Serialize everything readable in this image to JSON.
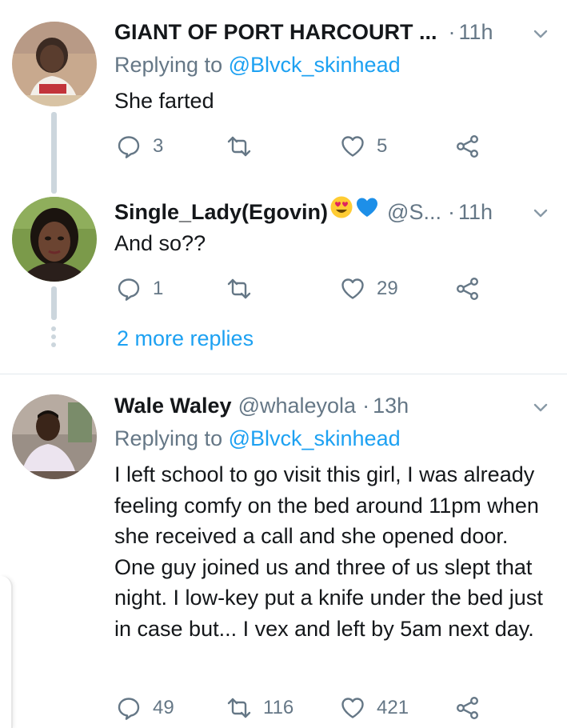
{
  "tweets": [
    {
      "name": "GIANT OF PORT HARCOURT ...",
      "handle": "",
      "time": "11h",
      "reply_prefix": "Replying to ",
      "reply_mention": "@Blvck_skinhead",
      "text": "She farted",
      "replies": "3",
      "retweets": "",
      "likes": "5"
    },
    {
      "name": "Single_Lady(Egovin)",
      "name_emojis": [
        "heart-eyes-emoji",
        "blue-heart-emoji"
      ],
      "handle": "@S...",
      "time": "11h",
      "text": "And so??",
      "replies": "1",
      "retweets": "",
      "likes": "29"
    },
    {
      "name": "Wale Waley",
      "handle": "@whaleyola",
      "time": "13h",
      "reply_prefix": "Replying to ",
      "reply_mention": "@Blvck_skinhead",
      "text": "I left school to go visit this girl, I was already feeling comfy on the bed around 11pm when she received a call and she opened door. One guy joined us and three of us slept that night. I low-key put a knife under the bed just in case but... I vex and left by 5am next day.",
      "replies": "49",
      "retweets": "116",
      "likes": "421"
    }
  ],
  "more_replies": "2 more replies",
  "separator": "·",
  "icons": {
    "reply": "reply-icon",
    "retweet": "retweet-icon",
    "like": "heart-icon",
    "share": "share-icon",
    "menu": "chevron-down-icon"
  },
  "colors": {
    "text": "#14171a",
    "secondary": "#657786",
    "link": "#1da1f2",
    "thread_line": "#ccd6dd",
    "divider": "#e1e8ed"
  }
}
